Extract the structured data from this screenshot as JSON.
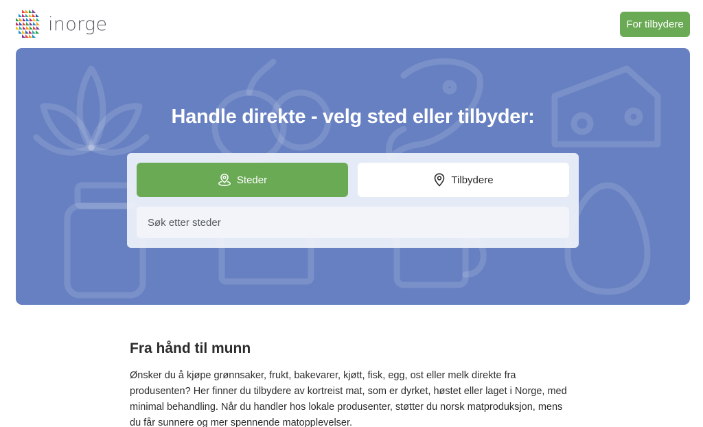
{
  "brand": {
    "name": "inorge"
  },
  "header": {
    "provider_button": "For tilbydere"
  },
  "hero": {
    "title": "Handle direkte - velg sted eller tilbyder:",
    "tabs": [
      {
        "label": "Steder",
        "icon": "map-pin-outline-icon",
        "active": true
      },
      {
        "label": "Tilbydere",
        "icon": "map-marker-icon",
        "active": false
      }
    ],
    "search": {
      "placeholder": "Søk etter steder",
      "value": ""
    }
  },
  "intro": {
    "heading": "Fra hånd til munn",
    "body": "Ønsker du å kjøpe grønnsaker, frukt, bakevarer, kjøtt, fisk, egg, ost eller melk direkte fra produsenten? Her finner du tilbydere av kortreist mat, som er dyrket, høstet eller laget i Norge, med minimal behandling. Når du handler hos lokale produsenter, støtter du norsk matproduksjon, mens du får sunnere og mer spennende matopplevelser."
  },
  "colors": {
    "accent_green": "#6aaa55",
    "hero_blue": "#6780c1"
  }
}
